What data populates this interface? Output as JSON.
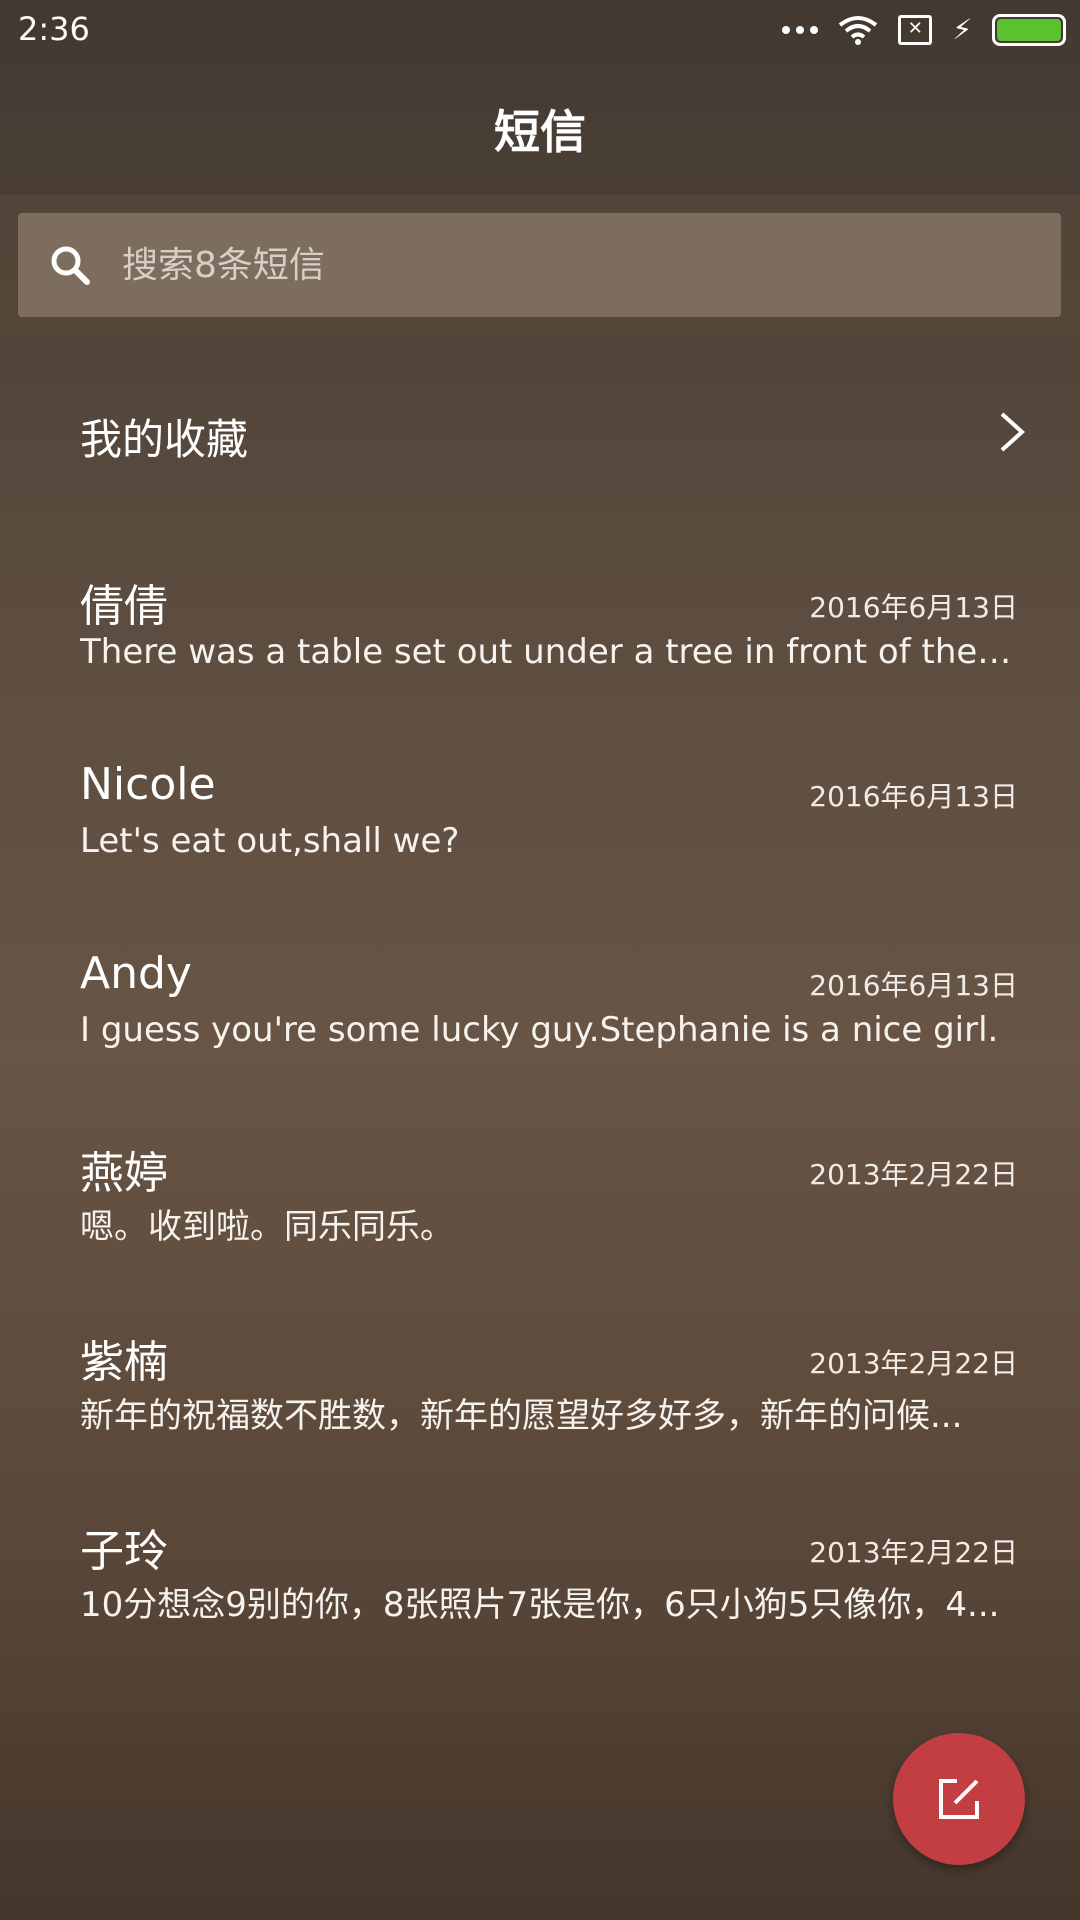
{
  "status_bar": {
    "time": "2:36",
    "icons": [
      "more-dots-icon",
      "wifi-icon",
      "no-sim-icon",
      "charging-bolt-icon",
      "battery-icon"
    ],
    "battery_color": "#5ac22e"
  },
  "header": {
    "title": "短信"
  },
  "search": {
    "placeholder": "搜索8条短信",
    "icon": "search-icon"
  },
  "favorites": {
    "label": "我的收藏",
    "icon": "chevron-right-icon"
  },
  "conversations": [
    {
      "name": "倩倩",
      "date": "2016年6月13日",
      "snippet": "There was a table set out under a tree in front of the ho..."
    },
    {
      "name": "Nicole",
      "date": "2016年6月13日",
      "snippet": "Let's eat out,shall we?"
    },
    {
      "name": "Andy",
      "date": "2016年6月13日",
      "snippet": "I guess you're some lucky guy.Stephanie is a nice girl."
    },
    {
      "name": "燕婷",
      "date": "2013年2月22日",
      "snippet": "嗯。收到啦。同乐同乐。"
    },
    {
      "name": "紫楠",
      "date": "2013年2月22日",
      "snippet": "新年的祝福数不胜数，新年的愿望好多好多，新年的问候..."
    },
    {
      "name": "子玲",
      "date": "2013年2月22日",
      "snippet": "10分想念9别的你，8张照片7张是你，6只小狗5只像你，4..."
    }
  ],
  "compose_button": {
    "icon": "compose-icon",
    "color": "#c33e43"
  }
}
